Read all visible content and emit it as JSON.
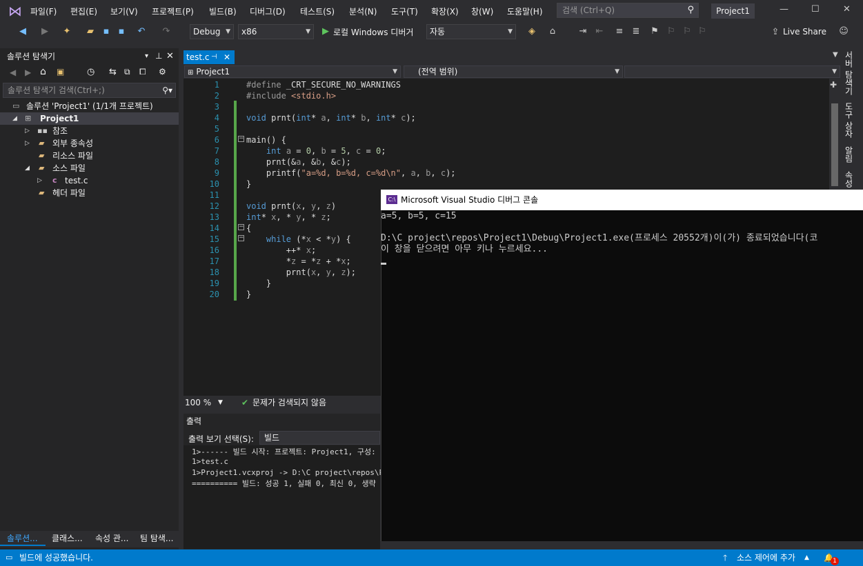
{
  "menubar": {
    "items": [
      "파일(F)",
      "편집(E)",
      "보기(V)",
      "프로젝트(P)",
      "빌드(B)",
      "디버그(D)",
      "테스트(S)",
      "분석(N)",
      "도구(T)",
      "확장(X)",
      "창(W)",
      "도움말(H)"
    ],
    "search_placeholder": "검색 (Ctrl+Q)",
    "project_title": "Project1"
  },
  "toolbar": {
    "config": "Debug",
    "platform": "x86",
    "run_label": "로컬 Windows 디버거",
    "run_mode": "자동",
    "live_share": "Live Share"
  },
  "solution_explorer": {
    "title": "솔루션 탐색기",
    "search_placeholder": "솔루션 탐색기 검색(Ctrl+;)",
    "tree": [
      {
        "label": "솔루션 'Project1' (1/1개 프로젝트)",
        "level": 0,
        "icon": "solution-icon"
      },
      {
        "label": "Project1",
        "level": 0,
        "icon": "project-icon",
        "bold": true,
        "selected": true
      },
      {
        "label": "참조",
        "level": 1,
        "icon": "reference-icon"
      },
      {
        "label": "외부 종속성",
        "level": 1,
        "icon": "folder-icon"
      },
      {
        "label": "리소스 파일",
        "level": 1,
        "icon": "folder-icon"
      },
      {
        "label": "소스 파일",
        "level": 1,
        "icon": "folder-icon"
      },
      {
        "label": "test.c",
        "level": 2,
        "icon": "c-file-icon"
      },
      {
        "label": "헤더 파일",
        "level": 1,
        "icon": "folder-icon"
      }
    ],
    "bottom_tabs": [
      "솔루션...",
      "클래스...",
      "속성 관...",
      "팀 탐색..."
    ]
  },
  "editor": {
    "tab": "test.c",
    "nav_project": "Project1",
    "nav_scope": "(전역 범위)",
    "zoom": "100 %",
    "issues": "문제가 검색되지 않음",
    "lines": [
      "#define _CRT_SECURE_NO_WARNINGS",
      "#include <stdio.h>",
      "",
      "void prnt(int* a, int* b, int* c);",
      "",
      "main() {",
      "    int a = 0, b = 5, c = 0;",
      "    prnt(&a, &b, &c);",
      "    printf(\"a=%d, b=%d, c=%d\\n\", a, b, c);",
      "}",
      "",
      "void prnt(x, y, z)",
      "int* x, * y, * z;",
      "{",
      "    while (*x < *y) {",
      "        ++* x;",
      "        *z = *z + *x;",
      "        prnt(x, y, z);",
      "    }",
      "}"
    ]
  },
  "output": {
    "title": "출력",
    "select_label": "출력 보기 선택(S):",
    "select_value": "빌드",
    "lines": [
      "1>------ 빌드 시작: 프로젝트: Project1, 구성:",
      "1>test.c",
      "1>Project1.vcxproj -> D:\\C project\\repos\\Proje",
      "========== 빌드: 성공 1, 실패 0, 최신 0, 생략"
    ]
  },
  "right_tabs": [
    "서버 탐색기",
    "도구 상자",
    "알림",
    "속성"
  ],
  "console": {
    "title": "Microsoft Visual Studio 디버그 콘솔",
    "lines": [
      "a=5, b=5, c=15",
      "",
      "D:\\C project\\repos\\Project1\\Debug\\Project1.exe(프로세스 20552개)이(가) 종료되었습니다(코",
      "이 창을 닫으려면 아무 키나 누르세요..."
    ]
  },
  "statusbar": {
    "message": "빌드에 성공했습니다.",
    "source_control": "소스 제어에 추가",
    "notifications": "1"
  }
}
